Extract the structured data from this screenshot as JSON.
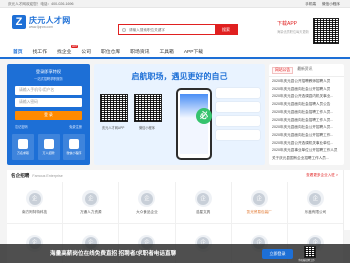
{
  "topbar": {
    "slogan": "庆元人才网欢迎您！电话：400-026-1696",
    "links": [
      "手机端",
      "微信小程序"
    ]
  },
  "header": {
    "logo_mark": "Z",
    "site_name": "庆元人才网",
    "site_url": "www.ljqrcw.com",
    "search_placeholder": "请输入搜索职位关键字",
    "search_button": "搜索",
    "app_title": "下载APP",
    "app_subtitle": "海量优质职位每天更新"
  },
  "nav": {
    "items": [
      {
        "label": "首页",
        "active": true
      },
      {
        "label": "找工作"
      },
      {
        "label": "找企业",
        "hot": "HOT"
      },
      {
        "label": "公司"
      },
      {
        "label": "职位仓库"
      },
      {
        "label": "职场资讯"
      },
      {
        "label": "工具箱"
      },
      {
        "label": "APP下载"
      }
    ]
  },
  "login": {
    "title": "登录即享特权",
    "subtitle": "一站式招聘求职服务",
    "username_placeholder": "请输入手机号/用户名",
    "password_placeholder": "请输入密码",
    "login_button": "登 录",
    "forgot": "忘记密码",
    "register": "免费注册",
    "tiles": [
      "万名求职",
      "万人招聘",
      "微信小程序"
    ]
  },
  "banner": {
    "title": "启航职场，遇见更好的自己",
    "qr_label_1": "庆元人才网APP",
    "qr_label_2": "微信小程序",
    "badge": "必"
  },
  "news": {
    "tabs": [
      "网站公告",
      "最新资讯"
    ],
    "items": [
      "2020年庆元县公开招聘教师招聘人员",
      "2020年庆元县面向社会公开招聘人员",
      "2020年庆元县公开选调县内机关事业...",
      "2020年庆元县面向社会招聘人员公告",
      "2020年庆元县面向社会招聘工作人员...",
      "2020年庆元县面向社会招聘工作人员...",
      "2020年庆元县面向社会公开招聘人员...",
      "2020年庆元县面向社会公开招聘工作...",
      "2020年庆元县公开选调机关事业单位...",
      "2020年庆元县事业单位公开招聘工作人员",
      "关于庆元县国有企业招聘工作人员..."
    ]
  },
  "companies": {
    "title": "名企招聘",
    "title_en": "Famous Enterprise",
    "more": "查看更多企业入驻 >",
    "items": [
      {
        "name": "南方阿特特科技"
      },
      {
        "name": "万通人力资源"
      },
      {
        "name": "大众食品企业"
      },
      {
        "name": "浩星文具"
      },
      {
        "name": "凯光贸易包装厂"
      },
      {
        "name": "乐鑫有限公司"
      },
      {
        "name": ""
      },
      {
        "name": ""
      },
      {
        "name": ""
      },
      {
        "name": ""
      },
      {
        "name": ""
      },
      {
        "name": ""
      }
    ],
    "logo_char": "企"
  },
  "bottom": {
    "message": "海量高薪岗位在线免费直招 招聘者/求职者电话直聊",
    "button": "立即登录",
    "qr_label": "手机端招聘工作"
  },
  "colors": {
    "brand_blue": "#1d6fd6",
    "accent_red": "#e02020",
    "login_orange": "#ff8a00"
  }
}
